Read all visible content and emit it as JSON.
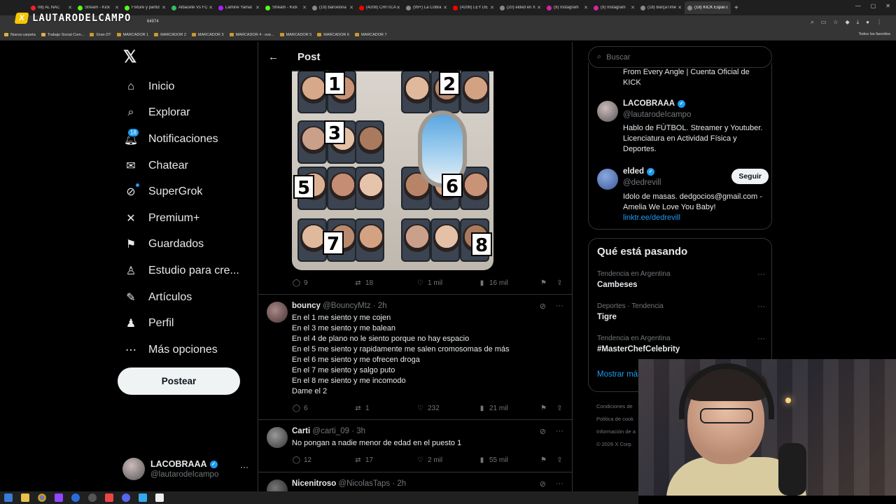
{
  "browser": {
    "tabs": [
      {
        "label": "08) AL NAC",
        "color": "#e23"
      },
      {
        "label": "Stream - Kick",
        "color": "#53fc18"
      },
      {
        "label": "Fixture y partid",
        "color": "#53fc18"
      },
      {
        "label": "Albacete Vs FC",
        "color": "#3b6"
      },
      {
        "label": "Lamine Yamal",
        "color": "#a2f"
      },
      {
        "label": "Stream - Kick",
        "color": "#53fc18"
      },
      {
        "label": "(19) barcelona",
        "color": "#888"
      },
      {
        "label": "(4208) CRITICA",
        "color": "#f00"
      },
      {
        "label": "(99+) La Cobra",
        "color": "#888"
      },
      {
        "label": "(4208) LEY DE",
        "color": "#f00"
      },
      {
        "label": "(20) elded en X",
        "color": "#888"
      },
      {
        "label": "(9) Instagram",
        "color": "#d6249f"
      },
      {
        "label": "(9) Instagram",
        "color": "#d6249f"
      },
      {
        "label": "(18) BarçaTime",
        "color": "#888"
      },
      {
        "label": "(18) KICK Españ",
        "color": "#888",
        "active": true
      }
    ],
    "url_fragment": "64974",
    "stream_logo_text": "LAUTARODELCAMPO",
    "stream_logo_badge": "X",
    "bookmarks": [
      "Nueva carpeta",
      "Trabajo Social Com...",
      "Gran DT",
      "MARCADOR 1",
      "MARCADOR 2",
      "MARCADOR 3",
      "MARCADOR 4 - ove...",
      "MARCADOR 5",
      "MARCADOR 6",
      "MARCADOR 7"
    ],
    "bookmarks_right": "Todos los favoritos"
  },
  "nav": {
    "items": [
      {
        "label": "Inicio",
        "icon": "home-icon"
      },
      {
        "label": "Explorar",
        "icon": "search-icon"
      },
      {
        "label": "Notificaciones",
        "icon": "bell-icon",
        "badge": "18"
      },
      {
        "label": "Chatear",
        "icon": "mail-icon"
      },
      {
        "label": "SuperGrok",
        "icon": "grok-icon"
      },
      {
        "label": "Premium+",
        "icon": "x-icon"
      },
      {
        "label": "Guardados",
        "icon": "bookmark-icon"
      },
      {
        "label": "Estudio para cre...",
        "icon": "studio-icon"
      },
      {
        "label": "Artículos",
        "icon": "article-icon"
      },
      {
        "label": "Perfil",
        "icon": "person-icon"
      },
      {
        "label": "Más opciones",
        "icon": "more-circle-icon"
      }
    ],
    "post_button": "Postear",
    "account": {
      "name": "LACOBRAAA",
      "handle": "@lautarodeIcampo",
      "more": "···"
    }
  },
  "main": {
    "title": "Post",
    "media_numbers": [
      "1",
      "2",
      "3",
      "5",
      "6",
      "7",
      "8"
    ],
    "post_stats": {
      "replies": "9",
      "reposts": "18",
      "likes": "1 mil",
      "views": "16 mil"
    },
    "replies": [
      {
        "name": "bouncy",
        "handle": "@BouncyMtz",
        "time": "· 2h",
        "lines": [
          "En el 1 me siento y me cojen",
          "En el 3 me siento y me balean",
          "En el 4 de plano no le siento porque no hay espacio",
          "En el 5 me siento y rapidamente me salen cromosomas de más",
          "En el 6 me siento y me ofrecen droga",
          "En el 7 me siento y salgo puto",
          "En el 8 me siento y me incomodo",
          "Dame el 2"
        ],
        "stats": {
          "replies": "6",
          "reposts": "1",
          "likes": "232",
          "views": "21 mil"
        }
      },
      {
        "name": "Carti",
        "handle": "@carti_09",
        "time": "· 3h",
        "lines": [
          "No pongan a nadie menor de edad en el puesto 1"
        ],
        "stats": {
          "replies": "12",
          "reposts": "17",
          "likes": "2 mil",
          "views": "55 mil"
        }
      },
      {
        "name": "Nicenitroso",
        "handle": "@NicolasTaps",
        "time": "· 2h",
        "lines": [],
        "stats": {}
      }
    ]
  },
  "right": {
    "search_placeholder": "Buscar",
    "who": [
      {
        "name": "",
        "handle": "",
        "bio": "From Every Angle | Cuenta Oficial de KICK"
      },
      {
        "name": "LACOBRAAA",
        "handle": "@lautarodeIcampo",
        "bio": "Hablo de FÚTBOL. Streamer y Youtuber. Licenciatura en Actividad Física y Deportes."
      },
      {
        "name": "elded",
        "handle": "@dedrevill",
        "bio": "Idolo de masas. dedgocios@gmail.com - Amelia We Love You Baby!",
        "link": "linktr.ee/dedrevill",
        "follow": "Seguir"
      }
    ],
    "trends_title": "Qué está pasando",
    "trends": [
      {
        "meta": "Tendencia en Argentina",
        "name": "Cambeses"
      },
      {
        "meta": "Deportes · Tendencia",
        "name": "Tigre"
      },
      {
        "meta": "Tendencia en Argentina",
        "name": "#MasterChefCelebrity"
      }
    ],
    "show_more": "Mostrar más",
    "footer": [
      "Condiciones de",
      "Política de cook",
      "Información de a",
      "© 2026 X Corp."
    ]
  },
  "colors": {
    "accent": "#1d9bf0",
    "text": "#e7e9ea",
    "muted": "#71767b",
    "border": "#2f3336"
  }
}
